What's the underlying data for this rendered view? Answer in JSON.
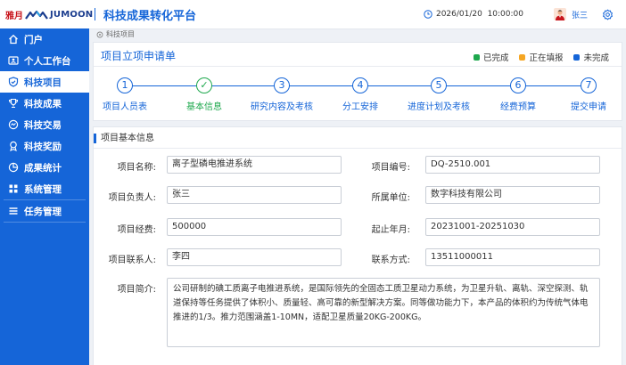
{
  "header": {
    "logo_cn": "雅月",
    "logo_en": "JUMOON",
    "app_title": "科技成果转化平台",
    "datetime": "2026/01/20  10:00:00",
    "username": "张三"
  },
  "sidebar": {
    "items": [
      {
        "label": "门户",
        "icon": "home-icon"
      },
      {
        "label": "个人工作台",
        "icon": "id-card-icon"
      },
      {
        "label": "科技项目",
        "icon": "shield-icon"
      },
      {
        "label": "科技成果",
        "icon": "trophy-icon"
      },
      {
        "label": "科技交易",
        "icon": "handshake-icon"
      },
      {
        "label": "科技奖励",
        "icon": "medal-icon"
      },
      {
        "label": "成果统计",
        "icon": "pie-chart-icon"
      },
      {
        "label": "系统管理",
        "icon": "grid-icon"
      },
      {
        "label": "任务管理",
        "icon": "list-icon"
      }
    ],
    "active_index": 2
  },
  "breadcrumb": {
    "text": "科技项目"
  },
  "form_header": {
    "title": "项目立项申请单",
    "legend": [
      {
        "label": "已完成",
        "color": "#1ea84d"
      },
      {
        "label": "正在填报",
        "color": "#f5a623"
      },
      {
        "label": "未完成",
        "color": "#1565d8"
      }
    ]
  },
  "steps": [
    {
      "num": "1",
      "label": "项目人员表",
      "status": "pending"
    },
    {
      "num": "✓",
      "label": "基本信息",
      "status": "done"
    },
    {
      "num": "3",
      "label": "研究内容及考核",
      "status": "pending"
    },
    {
      "num": "4",
      "label": "分工安排",
      "status": "pending"
    },
    {
      "num": "5",
      "label": "进度计划及考核",
      "status": "pending"
    },
    {
      "num": "6",
      "label": "经费预算",
      "status": "pending"
    },
    {
      "num": "7",
      "label": "提交申请",
      "status": "pending"
    }
  ],
  "basic_info": {
    "section_title": "项目基本信息",
    "fields": {
      "name": {
        "label": "项目名称:",
        "value": "离子型磷电推进系统"
      },
      "code": {
        "label": "项目编号:",
        "value": "DQ-2510.001"
      },
      "leader": {
        "label": "项目负责人:",
        "value": "张三"
      },
      "unit": {
        "label": "所属单位:",
        "value": "数字科技有限公司"
      },
      "budget": {
        "label": "项目经费:",
        "value": "500000"
      },
      "period": {
        "label": "起止年月:",
        "value": "20231001-20251030"
      },
      "contact": {
        "label": "项目联系人:",
        "value": "李四"
      },
      "phone": {
        "label": "联系方式:",
        "value": "13511000011"
      },
      "intro": {
        "label": "项目简介:",
        "value": "公司研制的碘工质离子电推进系统，是国际领先的全固态工质卫星动力系统，为卫星升轨、离轨、深空探测、轨道保持等任务提供了体积小、质量轻、高可靠的新型解决方案。同等做功能力下，本产品的体积约为传统气体电推进的1/3。推力范围涵盖1-10MN，适配卫星质量20KG-200KG。"
      }
    }
  }
}
